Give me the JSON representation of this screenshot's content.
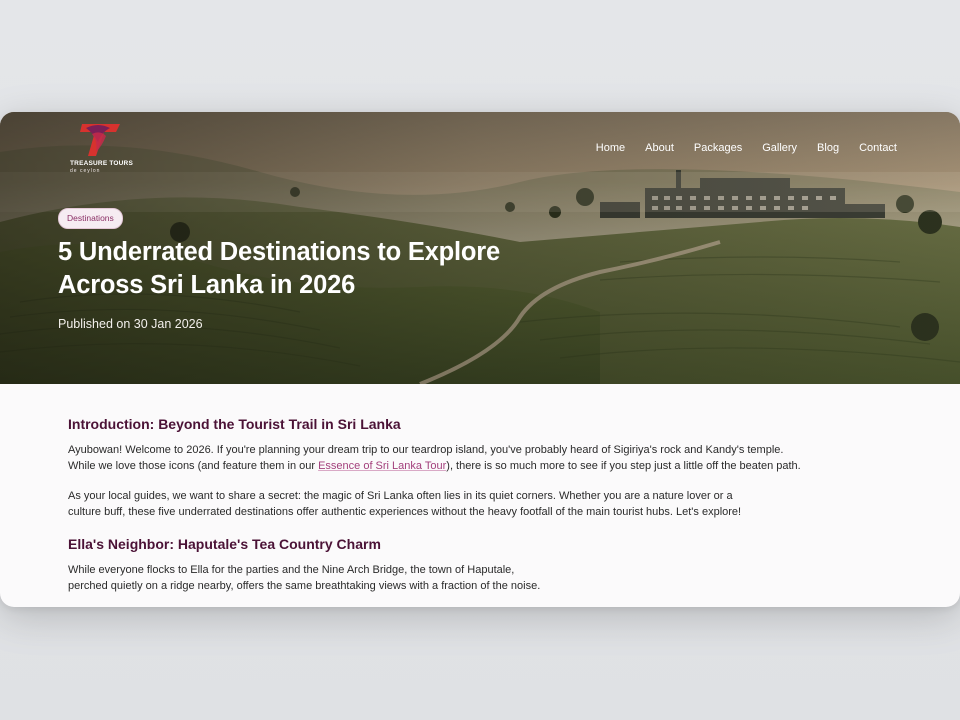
{
  "brand": {
    "name": "TREASURE TOURS",
    "tagline": "de ceylon",
    "colors": {
      "logo_red": "#d7322e",
      "logo_purple": "#7a1f57",
      "accent": "#a3407c",
      "heading": "#4b1236"
    }
  },
  "nav": {
    "items": [
      {
        "label": "Home"
      },
      {
        "label": "About"
      },
      {
        "label": "Packages"
      },
      {
        "label": "Gallery"
      },
      {
        "label": "Blog"
      },
      {
        "label": "Contact"
      }
    ]
  },
  "hero": {
    "badge": "Destinations",
    "title": "5 Underrated Destinations to Explore Across Sri Lanka in 2026",
    "published": "Published on 30 Jan 2026"
  },
  "article": {
    "intro_heading": "Introduction: Beyond the Tourist Trail in Sri Lanka",
    "p1_line1": "Ayubowan! Welcome to 2026. If you're planning your dream trip to our teardrop island, you've probably heard of Sigiriya's rock and Kandy's temple.",
    "p1_line2_before": "While we love those icons (and feature them in our ",
    "p1_link": "Essence of Sri Lanka Tour",
    "p1_line2_after": "), there is so much more to see if you step just a little off the beaten path.",
    "p2_line1": "As your local guides, we want to share a secret: the magic of Sri Lanka often lies in its quiet corners. Whether you are a nature lover or a",
    "p2_line2": "culture buff, these five underrated destinations offer authentic experiences without the heavy footfall of the main tourist hubs. Let's explore!",
    "section2_heading": "Ella's Neighbor: Haputale's Tea Country Charm",
    "p3_line1": "While everyone flocks to Ella for the parties and the Nine Arch Bridge, the town of Haputale,",
    "p3_line2": "perched quietly on a ridge nearby, offers the same breathtaking views with a fraction of the noise."
  }
}
